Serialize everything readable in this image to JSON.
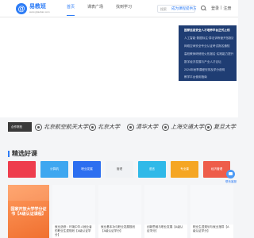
{
  "brand": {
    "mark": "@",
    "name": "易教班",
    "sub": "www.yijiaoban.com"
  },
  "nav": {
    "items": [
      "首页",
      "课表广场",
      "找到学习"
    ]
  },
  "search": {
    "placeholder": "搜索",
    "become_link": "成为课程提供方"
  },
  "icons": {
    "search": "search-icon"
  },
  "auth": {
    "login": "登录",
    "sep": "|",
    "register": "注册"
  },
  "hero": {
    "links": [
      "国家信息安全人才培养平台正式上线",
      "人工智能·数据标注·算法训练营开放报名中",
      "网络空间安全专业认证考试报名通知",
      "高校教师研修班火热报名·实践能力提升",
      "数字经济发展与产业人才论坛",
      "2024年秋季课程安排及学分说明",
      "教学平台使用指南"
    ]
  },
  "partners": {
    "label": "合作院校",
    "universities": [
      "北京航空航天大学",
      "北京大学",
      "清华大学",
      "上海交通大学",
      "复旦大学"
    ]
  },
  "courses": {
    "title": "精选好课",
    "categories": [
      {
        "label": "",
        "color": "#ee3d4d"
      },
      {
        "label": "计算机",
        "color": "#3ea7f0"
      },
      {
        "label": "职业发展",
        "color": "#2d6ff0"
      },
      {
        "label": "管理",
        "color": "#f0f2f5"
      },
      {
        "label": "语言",
        "color": "#30b9e8"
      },
      {
        "label": "专业课",
        "color": "#f5a623"
      },
      {
        "label": "经济管理",
        "color": "#ee5d4a"
      }
    ],
    "featured_text": "国家开放大学学分证书【A级认证课程】",
    "items": [
      "就业选修：环境中华人就业者的职业生涯规划【A级认证学分】",
      "就业基本功与职业发展规划【A级认证学分】",
      "创新思维与职业发展【A级认证学分】",
      "职业生涯规划与就业指导【A级认证学分】"
    ]
  },
  "float_widget": {
    "label": "联系客服"
  }
}
